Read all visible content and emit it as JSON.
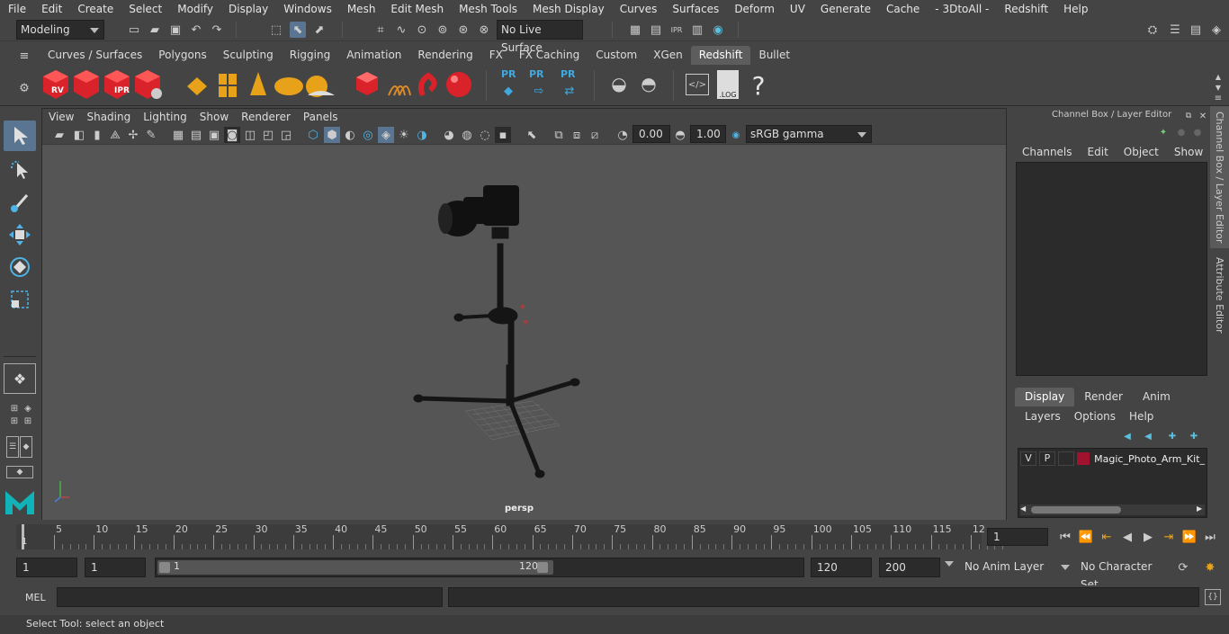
{
  "menubar": [
    "File",
    "Edit",
    "Create",
    "Select",
    "Modify",
    "Display",
    "Windows",
    "Mesh",
    "Edit Mesh",
    "Mesh Tools",
    "Mesh Display",
    "Curves",
    "Surfaces",
    "Deform",
    "UV",
    "Generate",
    "Cache",
    "- 3DtoAll -",
    "Redshift",
    "Help"
  ],
  "status": {
    "mode": "Modeling",
    "live_surface": "No Live Surface"
  },
  "shelf_tabs": [
    "Curves / Surfaces",
    "Polygons",
    "Sculpting",
    "Rigging",
    "Animation",
    "Rendering",
    "FX",
    "FX Caching",
    "Custom",
    "XGen",
    "Redshift",
    "Bullet"
  ],
  "active_shelf_tab": "Redshift",
  "shelf_labels": {
    "rv": "RV",
    "ipr": "IPR",
    "pr1": "PR",
    "pr2": "PR",
    "pr3": "PR",
    "log": ".LOG",
    "help": "?"
  },
  "viewport": {
    "menu": [
      "View",
      "Shading",
      "Lighting",
      "Show",
      "Renderer",
      "Panels"
    ],
    "exposure": "0.00",
    "gamma": "1.00",
    "colorspace": "sRGB gamma",
    "camera": "persp"
  },
  "channel_box": {
    "title": "Channel Box / Layer Editor",
    "menu": [
      "Channels",
      "Edit",
      "Object",
      "Show"
    ]
  },
  "layer_editor": {
    "tabs": [
      "Display",
      "Render",
      "Anim"
    ],
    "active_tab": "Display",
    "menu": [
      "Layers",
      "Options",
      "Help"
    ],
    "layer": {
      "v": "V",
      "p": "P",
      "name": "Magic_Photo_Arm_Kit_",
      "color": "#a0122e"
    }
  },
  "side_tabs": [
    "Channel Box / Layer Editor",
    "Attribute Editor"
  ],
  "timeline": {
    "ticks": [
      "5",
      "10",
      "15",
      "20",
      "25",
      "30",
      "35",
      "40",
      "45",
      "50",
      "55",
      "60",
      "65",
      "70",
      "75",
      "80",
      "85",
      "90",
      "95",
      "100",
      "105",
      "110",
      "115",
      "12"
    ],
    "start_label": "1",
    "current_frame": "1"
  },
  "range": {
    "start": "1",
    "start2": "1",
    "slider_start": "1",
    "slider_end": "120",
    "end": "120",
    "max": "200",
    "anim_layer": "No Anim Layer",
    "char_set": "No Character Set"
  },
  "command": {
    "lang": "MEL"
  },
  "help_line": "Select Tool: select an object",
  "colors": {
    "accent": "#5a7592",
    "active_tab": "#5d5d5d",
    "redshift_red": "#d9222a",
    "gold": "#e8a21a",
    "pr_blue": "#3fa9e0"
  }
}
